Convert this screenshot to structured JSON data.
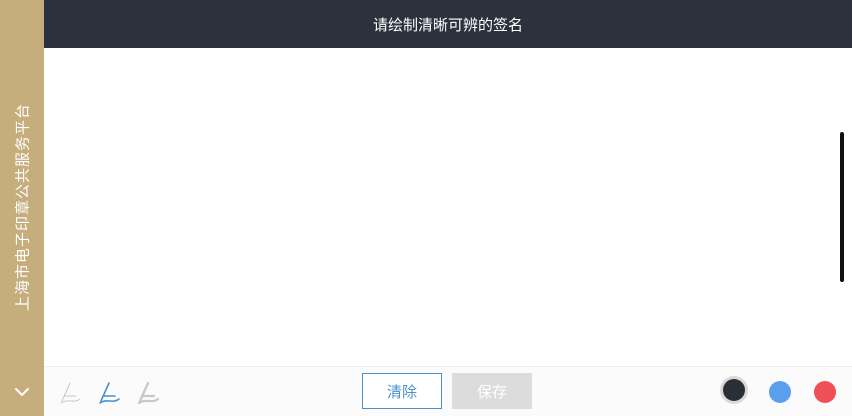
{
  "sidebar": {
    "title": "上海市电子印章公共服务平台"
  },
  "header": {
    "title": "请绘制清晰可辨的签名"
  },
  "toolbar": {
    "clear_label": "清除",
    "save_label": "保存",
    "pens": [
      {
        "name": "thin-pen-icon",
        "color": "#c8c8c8"
      },
      {
        "name": "medium-pen-icon",
        "color": "#4a90c9"
      },
      {
        "name": "thick-pen-icon",
        "color": "#c8c8c8"
      }
    ],
    "colors": [
      "#2a2e36",
      "#5aa0ee",
      "#ef4f57"
    ]
  }
}
